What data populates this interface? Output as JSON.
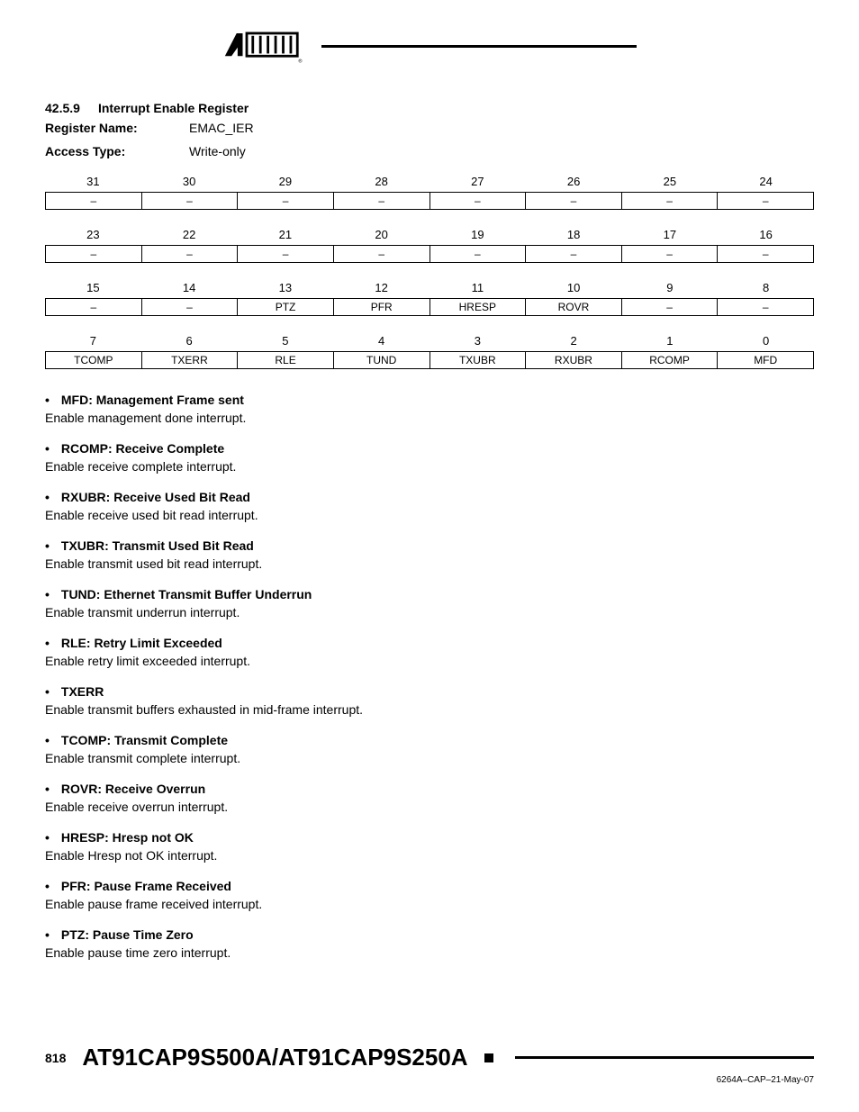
{
  "header": {
    "section_num": "42.5.9",
    "section_title": "Interrupt Enable Register",
    "register_name_label": "Register Name:",
    "register_name_value": "EMAC_IER",
    "access_type_label": "Access Type:",
    "access_type_value": "Write-only"
  },
  "bit_rows": [
    {
      "headers": [
        "31",
        "30",
        "29",
        "28",
        "27",
        "26",
        "25",
        "24"
      ],
      "values": [
        "–",
        "–",
        "–",
        "–",
        "–",
        "–",
        "–",
        "–"
      ]
    },
    {
      "headers": [
        "23",
        "22",
        "21",
        "20",
        "19",
        "18",
        "17",
        "16"
      ],
      "values": [
        "–",
        "–",
        "–",
        "–",
        "–",
        "–",
        "–",
        "–"
      ]
    },
    {
      "headers": [
        "15",
        "14",
        "13",
        "12",
        "11",
        "10",
        "9",
        "8"
      ],
      "values": [
        "–",
        "–",
        "PTZ",
        "PFR",
        "HRESP",
        "ROVR",
        "–",
        "–"
      ]
    },
    {
      "headers": [
        "7",
        "6",
        "5",
        "4",
        "3",
        "2",
        "1",
        "0"
      ],
      "values": [
        "TCOMP",
        "TXERR",
        "RLE",
        "TUND",
        "TXUBR",
        "RXUBR",
        "RCOMP",
        "MFD"
      ]
    }
  ],
  "descriptions": [
    {
      "title": "MFD: Management Frame sent",
      "text": "Enable management done interrupt."
    },
    {
      "title": "RCOMP: Receive Complete",
      "text": "Enable receive complete interrupt."
    },
    {
      "title": "RXUBR: Receive Used Bit Read",
      "text": "Enable receive used bit read interrupt."
    },
    {
      "title": "TXUBR: Transmit Used Bit Read",
      "text": "Enable transmit used bit read interrupt."
    },
    {
      "title": "TUND: Ethernet Transmit Buffer Underrun",
      "text": "Enable transmit underrun interrupt."
    },
    {
      "title": "RLE: Retry Limit Exceeded",
      "text": "Enable retry limit exceeded interrupt."
    },
    {
      "title": "TXERR",
      "text": "Enable transmit buffers exhausted in mid-frame interrupt."
    },
    {
      "title": "TCOMP: Transmit Complete",
      "text": "Enable transmit complete interrupt."
    },
    {
      "title": "ROVR: Receive Overrun",
      "text": "Enable receive overrun interrupt."
    },
    {
      "title": "HRESP: Hresp not OK",
      "text": "Enable Hresp not OK interrupt."
    },
    {
      "title": "PFR: Pause Frame Received",
      "text": "Enable pause frame received interrupt."
    },
    {
      "title": "PTZ: Pause Time Zero",
      "text": "Enable pause time zero interrupt."
    }
  ],
  "footer": {
    "page_num": "818",
    "doc_title": "AT91CAP9S500A/AT91CAP9S250A",
    "doc_code": "6264A–CAP–21-May-07"
  }
}
